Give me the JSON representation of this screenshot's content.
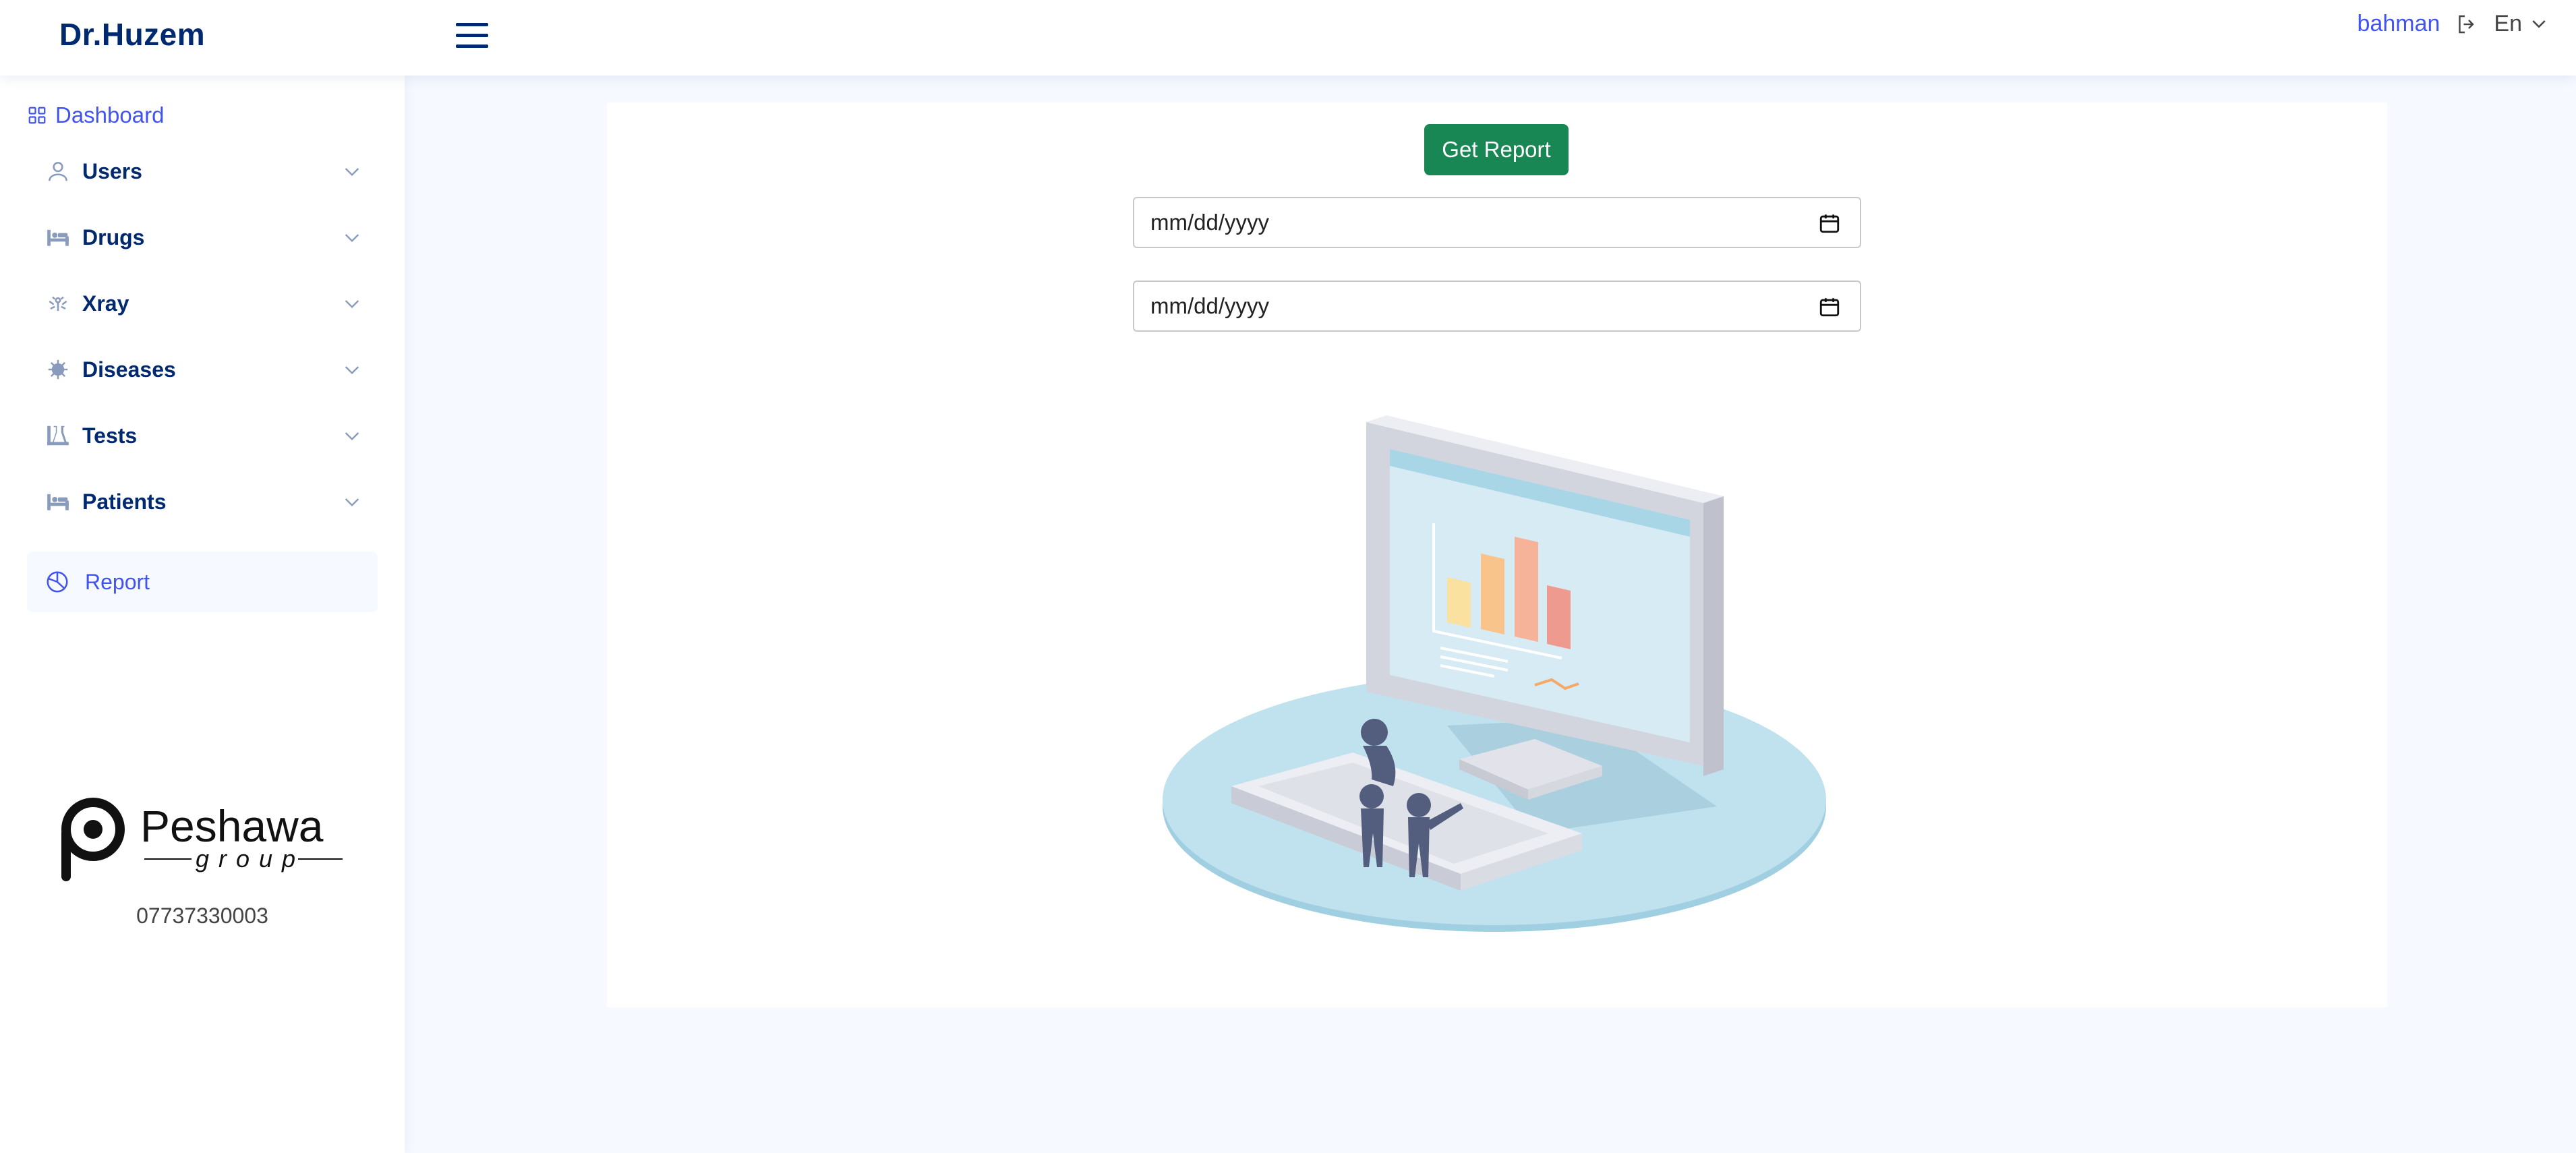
{
  "header": {
    "logo": "Dr.Huzem",
    "username": "bahman",
    "language": "En"
  },
  "sidebar": {
    "dashboard_label": "Dashboard",
    "items": [
      {
        "label": "Users",
        "icon": "user-icon"
      },
      {
        "label": "Drugs",
        "icon": "bed-icon"
      },
      {
        "label": "Xray",
        "icon": "xray-icon"
      },
      {
        "label": "Diseases",
        "icon": "virus-icon"
      },
      {
        "label": "Tests",
        "icon": "flask-icon"
      },
      {
        "label": "Patients",
        "icon": "bed-icon"
      }
    ],
    "report_label": "Report",
    "brand_name": "Peshawa",
    "brand_sub": "group",
    "phone": "07737330003"
  },
  "main": {
    "get_report_label": "Get Report",
    "date_from_placeholder": "mm/dd/yyyy",
    "date_to_placeholder": "mm/dd/yyyy"
  },
  "colors": {
    "primary": "#012970",
    "accent": "#4154f1",
    "button_green": "#198754",
    "page_bg": "#f6f9ff"
  }
}
